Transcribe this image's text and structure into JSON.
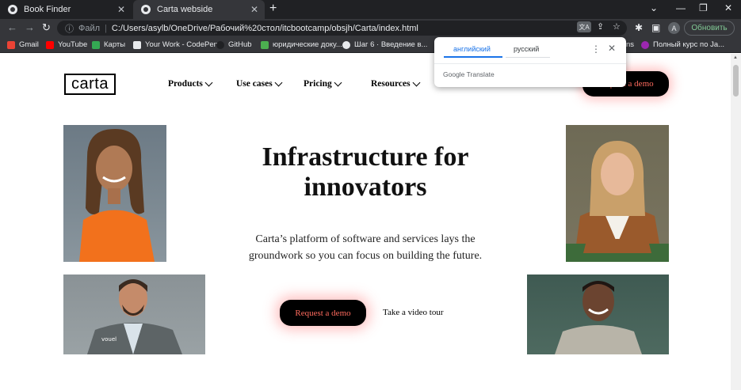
{
  "browser": {
    "tabs": [
      {
        "title": "Book Finder"
      },
      {
        "title": "Carta webside"
      }
    ],
    "new_tab": "+",
    "window_controls": {
      "minimize": "⌄",
      "min": "—",
      "restore": "❐",
      "close": "✕"
    },
    "omnibox": {
      "scheme_label": "Файл",
      "url": "C:/Users/asylb/OneDrive/Рабочий%20стол/itcbootcamp/obsjh/Carta/index.html"
    },
    "profile_initial": "A",
    "update_label": "Обновить",
    "bookmarks": [
      {
        "label": "Gmail",
        "color": "#ea4335"
      },
      {
        "label": "YouTube",
        "color": "#ff0000"
      },
      {
        "label": "Карты",
        "color": "#34a853"
      },
      {
        "label": "Your Work - CodePen",
        "color": "#e8eaed"
      },
      {
        "label": "GitHub",
        "color": "#202124"
      },
      {
        "label": "юридические доку...",
        "color": "#4caf50"
      },
      {
        "label": "Шаг 6 · Введение в...",
        "color": "#e8eaed"
      },
      {
        "label": "ns",
        "color": "#35363a"
      },
      {
        "label": "Полный курс по Ja...",
        "color": "#9c27b0"
      }
    ]
  },
  "translate_popup": {
    "source_lang": "английский",
    "target_lang": "русский",
    "brand_google": "Google",
    "brand_translate": "Translate"
  },
  "site": {
    "logo": "carta",
    "nav": [
      {
        "label": "Products"
      },
      {
        "label": "Use cases"
      },
      {
        "label": "Pricing"
      },
      {
        "label": "Resources"
      }
    ],
    "cta_top": "Request a demo",
    "headline": "Infrastructure for innovators",
    "subheadline": "Carta’s platform of software and services lays the groundwork so you can focus on building the future.",
    "cta_main": "Request a demo",
    "video_link": "Take a video tour",
    "vest_text": "vouel"
  },
  "colors": {
    "accent": "#ff6b5e",
    "cta_bg": "#000000",
    "chrome_dark": "#202124",
    "chrome_mid": "#35363a"
  }
}
